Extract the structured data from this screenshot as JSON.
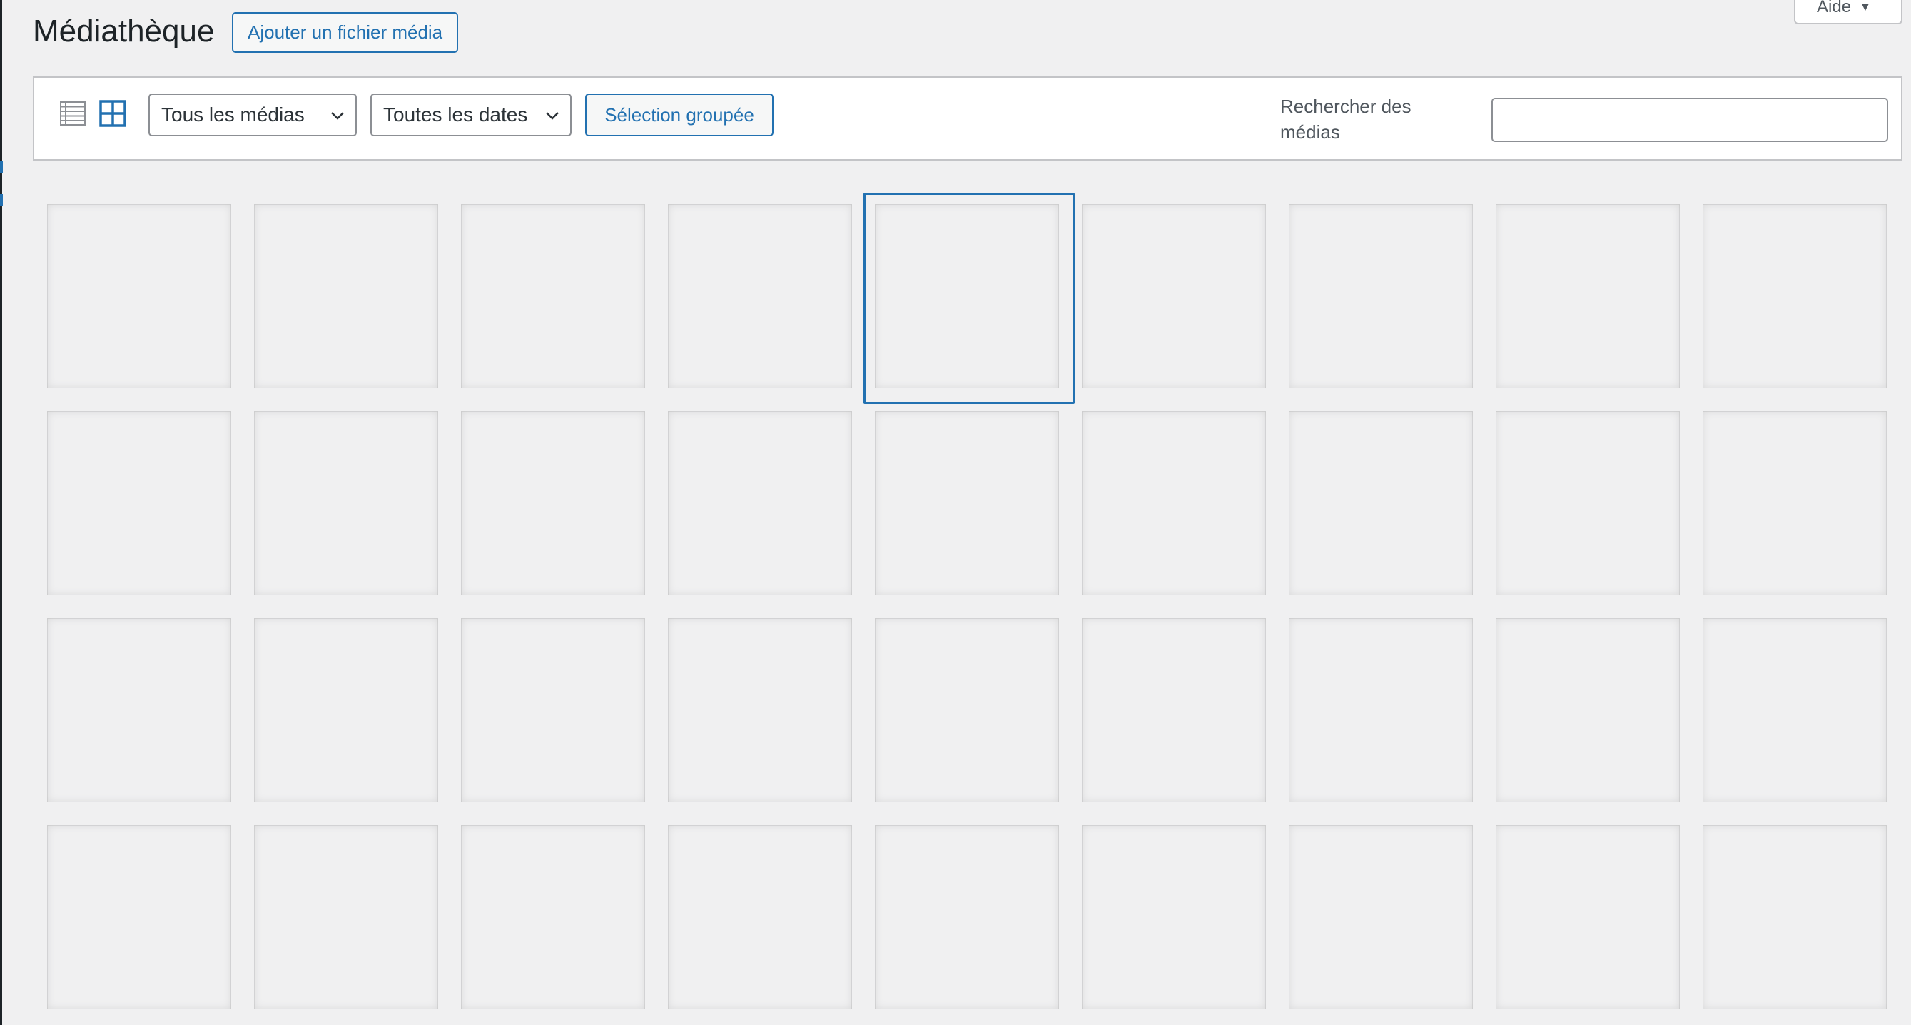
{
  "header": {
    "title": "Médiathèque",
    "add_media_label": "Ajouter un fichier média",
    "help_label": "Aide"
  },
  "toolbar": {
    "view_modes": [
      {
        "icon": "list-view-icon",
        "active": false
      },
      {
        "icon": "grid-view-icon",
        "active": true
      }
    ],
    "type_filter": {
      "selected": "Tous les médias"
    },
    "date_filter": {
      "selected": "Toutes les dates"
    },
    "bulk_select_label": "Sélection groupée",
    "search": {
      "label": "Rechercher des médias",
      "value": ""
    }
  },
  "media_grid": {
    "rows": 4,
    "columns": 9,
    "focused_index": 4
  },
  "colors": {
    "accent": "#2271b1",
    "background": "#f0f0f1",
    "panel": "#ffffff",
    "border": "#c3c4c7"
  }
}
